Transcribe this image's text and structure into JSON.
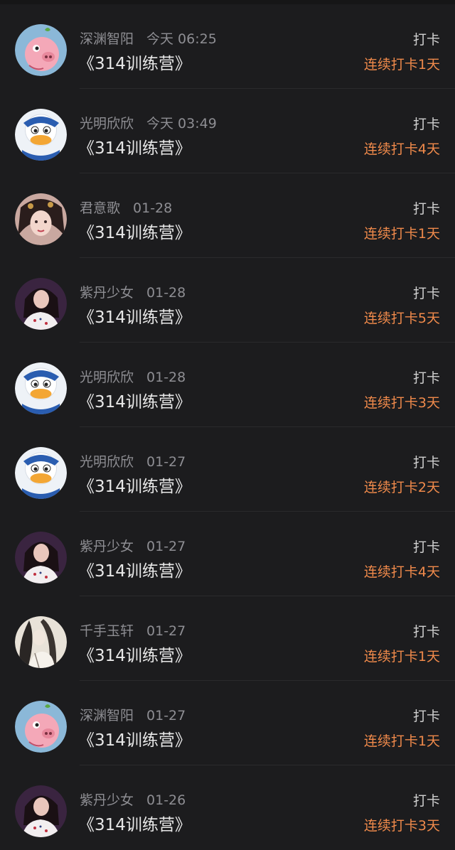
{
  "colors": {
    "background": "#1c1c1e",
    "meta_text": "#8e8e93",
    "title_text": "#e8e8e8",
    "streak_accent": "#f08a4b"
  },
  "records": [
    {
      "user": "深渊智阳",
      "time": "今天 06:25",
      "title": "《314训练营》",
      "action": "打卡",
      "streak": "连续打卡1天",
      "avatar": "pink-pig-avatar-icon"
    },
    {
      "user": "光明欣欣",
      "time": "今天 03:49",
      "title": "《314训练营》",
      "action": "打卡",
      "streak": "连续打卡4天",
      "avatar": "donald-duck-avatar-icon"
    },
    {
      "user": "君意歌",
      "time": "01-28",
      "title": "《314训练营》",
      "action": "打卡",
      "streak": "连续打卡1天",
      "avatar": "ancient-style-girl-avatar-icon"
    },
    {
      "user": "紫丹少女",
      "time": "01-28",
      "title": "《314训练营》",
      "action": "打卡",
      "streak": "连续打卡5天",
      "avatar": "woman-portrait-avatar-icon"
    },
    {
      "user": "光明欣欣",
      "time": "01-28",
      "title": "《314训练营》",
      "action": "打卡",
      "streak": "连续打卡3天",
      "avatar": "donald-duck-avatar-icon"
    },
    {
      "user": "光明欣欣",
      "time": "01-27",
      "title": "《314训练营》",
      "action": "打卡",
      "streak": "连续打卡2天",
      "avatar": "donald-duck-avatar-icon"
    },
    {
      "user": "紫丹少女",
      "time": "01-27",
      "title": "《314训练营》",
      "action": "打卡",
      "streak": "连续打卡4天",
      "avatar": "woman-portrait-avatar-icon"
    },
    {
      "user": "千手玉轩",
      "time": "01-27",
      "title": "《314训练营》",
      "action": "打卡",
      "streak": "连续打卡1天",
      "avatar": "ink-painting-avatar-icon"
    },
    {
      "user": "深渊智阳",
      "time": "01-27",
      "title": "《314训练营》",
      "action": "打卡",
      "streak": "连续打卡1天",
      "avatar": "pink-pig-avatar-icon"
    },
    {
      "user": "紫丹少女",
      "time": "01-26",
      "title": "《314训练营》",
      "action": "打卡",
      "streak": "连续打卡3天",
      "avatar": "woman-portrait-avatar-icon"
    }
  ]
}
